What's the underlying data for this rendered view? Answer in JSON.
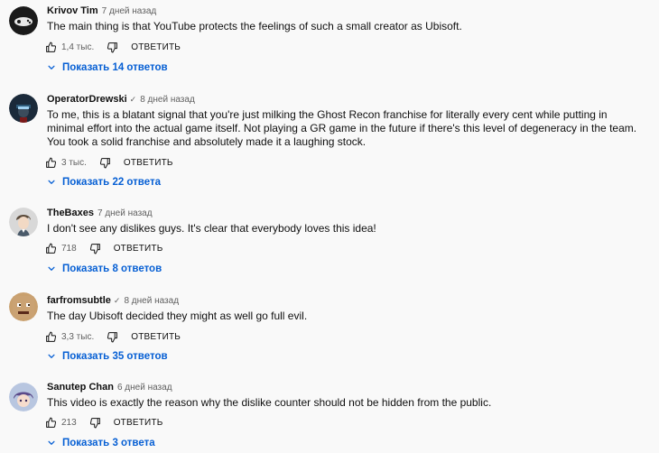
{
  "comments": [
    {
      "author": "Krivov Tim",
      "verified": false,
      "time": "7 дней назад",
      "text": "The main thing is that YouTube protects the feelings of such a small creator as Ubisoft.",
      "likes": "1,4 тыс.",
      "reply_label": "ОТВЕТИТЬ",
      "replies_label": "Показать 14 ответов",
      "avatar_icon": "gamepad-avatar"
    },
    {
      "author": "OperatorDrewski",
      "verified": true,
      "verified_mark": "✓",
      "time": "8 дней назад",
      "text": "To me, this is a blatant signal that you're just milking the Ghost Recon franchise for literally every cent while putting in minimal effort into the actual game itself. Not playing a GR game in the future if there's this level of degeneracy in the team. You took a solid franchise and absolutely made it a laughing stock.",
      "likes": "3 тыс.",
      "reply_label": "ОТВЕТИТЬ",
      "replies_label": "Показать 22 ответа",
      "avatar_icon": "soldier-avatar"
    },
    {
      "author": "TheBaxes",
      "verified": false,
      "time": "7 дней назад",
      "text": "I don't see any dislikes guys. It's clear that everybody loves this idea!",
      "likes": "718",
      "reply_label": "ОТВЕТИТЬ",
      "replies_label": "Показать 8 ответов",
      "avatar_icon": "anime-character-avatar"
    },
    {
      "author": "farfromsubtle",
      "verified": true,
      "verified_mark": "✓",
      "time": "8 дней назад",
      "text": "The day Ubisoft decided they might as well go full evil.",
      "likes": "3,3 тыс.",
      "reply_label": "ОТВЕТИТЬ",
      "replies_label": "Показать 35 ответов",
      "avatar_icon": "pixel-face-avatar"
    },
    {
      "author": "Sanutep Chan",
      "verified": false,
      "time": "6 дней назад",
      "text": "This video is exactly the reason why the dislike counter should not be hidden from the public.",
      "likes": "213",
      "reply_label": "ОТВЕТИТЬ",
      "replies_label": "Показать 3 ответа",
      "avatar_icon": "anime-girl-avatar"
    }
  ],
  "colors": {
    "background": "#f9f9f9",
    "text": "#0f0f0f",
    "secondary": "#606060",
    "link": "#065fd4"
  }
}
